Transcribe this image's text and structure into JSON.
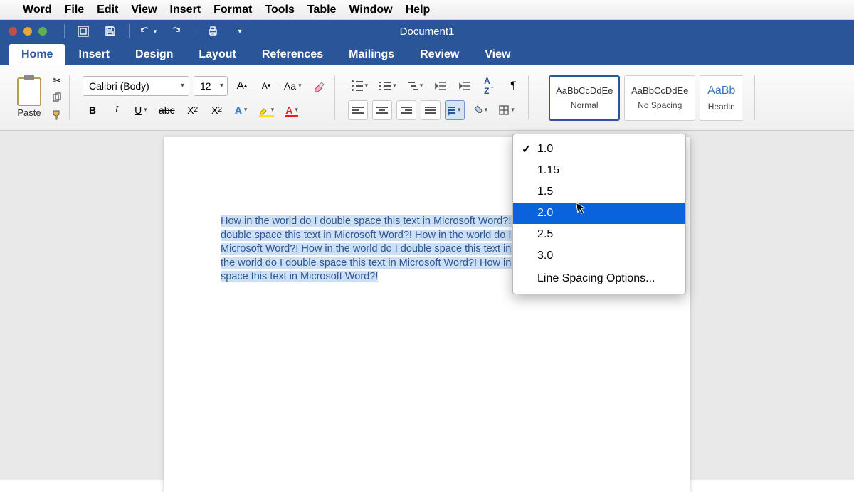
{
  "mac_menu": {
    "app": "Word",
    "items": [
      "File",
      "Edit",
      "View",
      "Insert",
      "Format",
      "Tools",
      "Table",
      "Window",
      "Help"
    ]
  },
  "titlebar": {
    "document_name": "Document1"
  },
  "ribbon_tabs": {
    "active": "Home",
    "items": [
      "Home",
      "Insert",
      "Design",
      "Layout",
      "References",
      "Mailings",
      "Review",
      "View"
    ]
  },
  "clipboard": {
    "paste_label": "Paste"
  },
  "font": {
    "name": "Calibri (Body)",
    "size": "12",
    "bold": "B",
    "italic": "I",
    "underline": "U",
    "strike": "abc",
    "sub": "X",
    "sup": "X",
    "grow": "A",
    "shrink": "A",
    "changecase": "Aa"
  },
  "styles": {
    "sample": "AaBbCcDdEe",
    "sample_heading": "AaBb",
    "normal": "Normal",
    "nospacing": "No Spacing",
    "heading": "Headin"
  },
  "line_spacing_menu": {
    "options": [
      "1.0",
      "1.15",
      "1.5",
      "2.0",
      "2.5",
      "3.0"
    ],
    "checked": "1.0",
    "selected": "2.0",
    "options_label": "Line Spacing Options..."
  },
  "document_text": "How in the world do I double space this text in Microsoft Word?! How in the world do I double space this text in Microsoft Word?! How in the world do I double space this text in Microsoft Word?! How in the world do I double space this text in Microsoft Word?! How in the world do I double space this text in Microsoft Word?! How in the world do I double space this text in Microsoft Word?!"
}
